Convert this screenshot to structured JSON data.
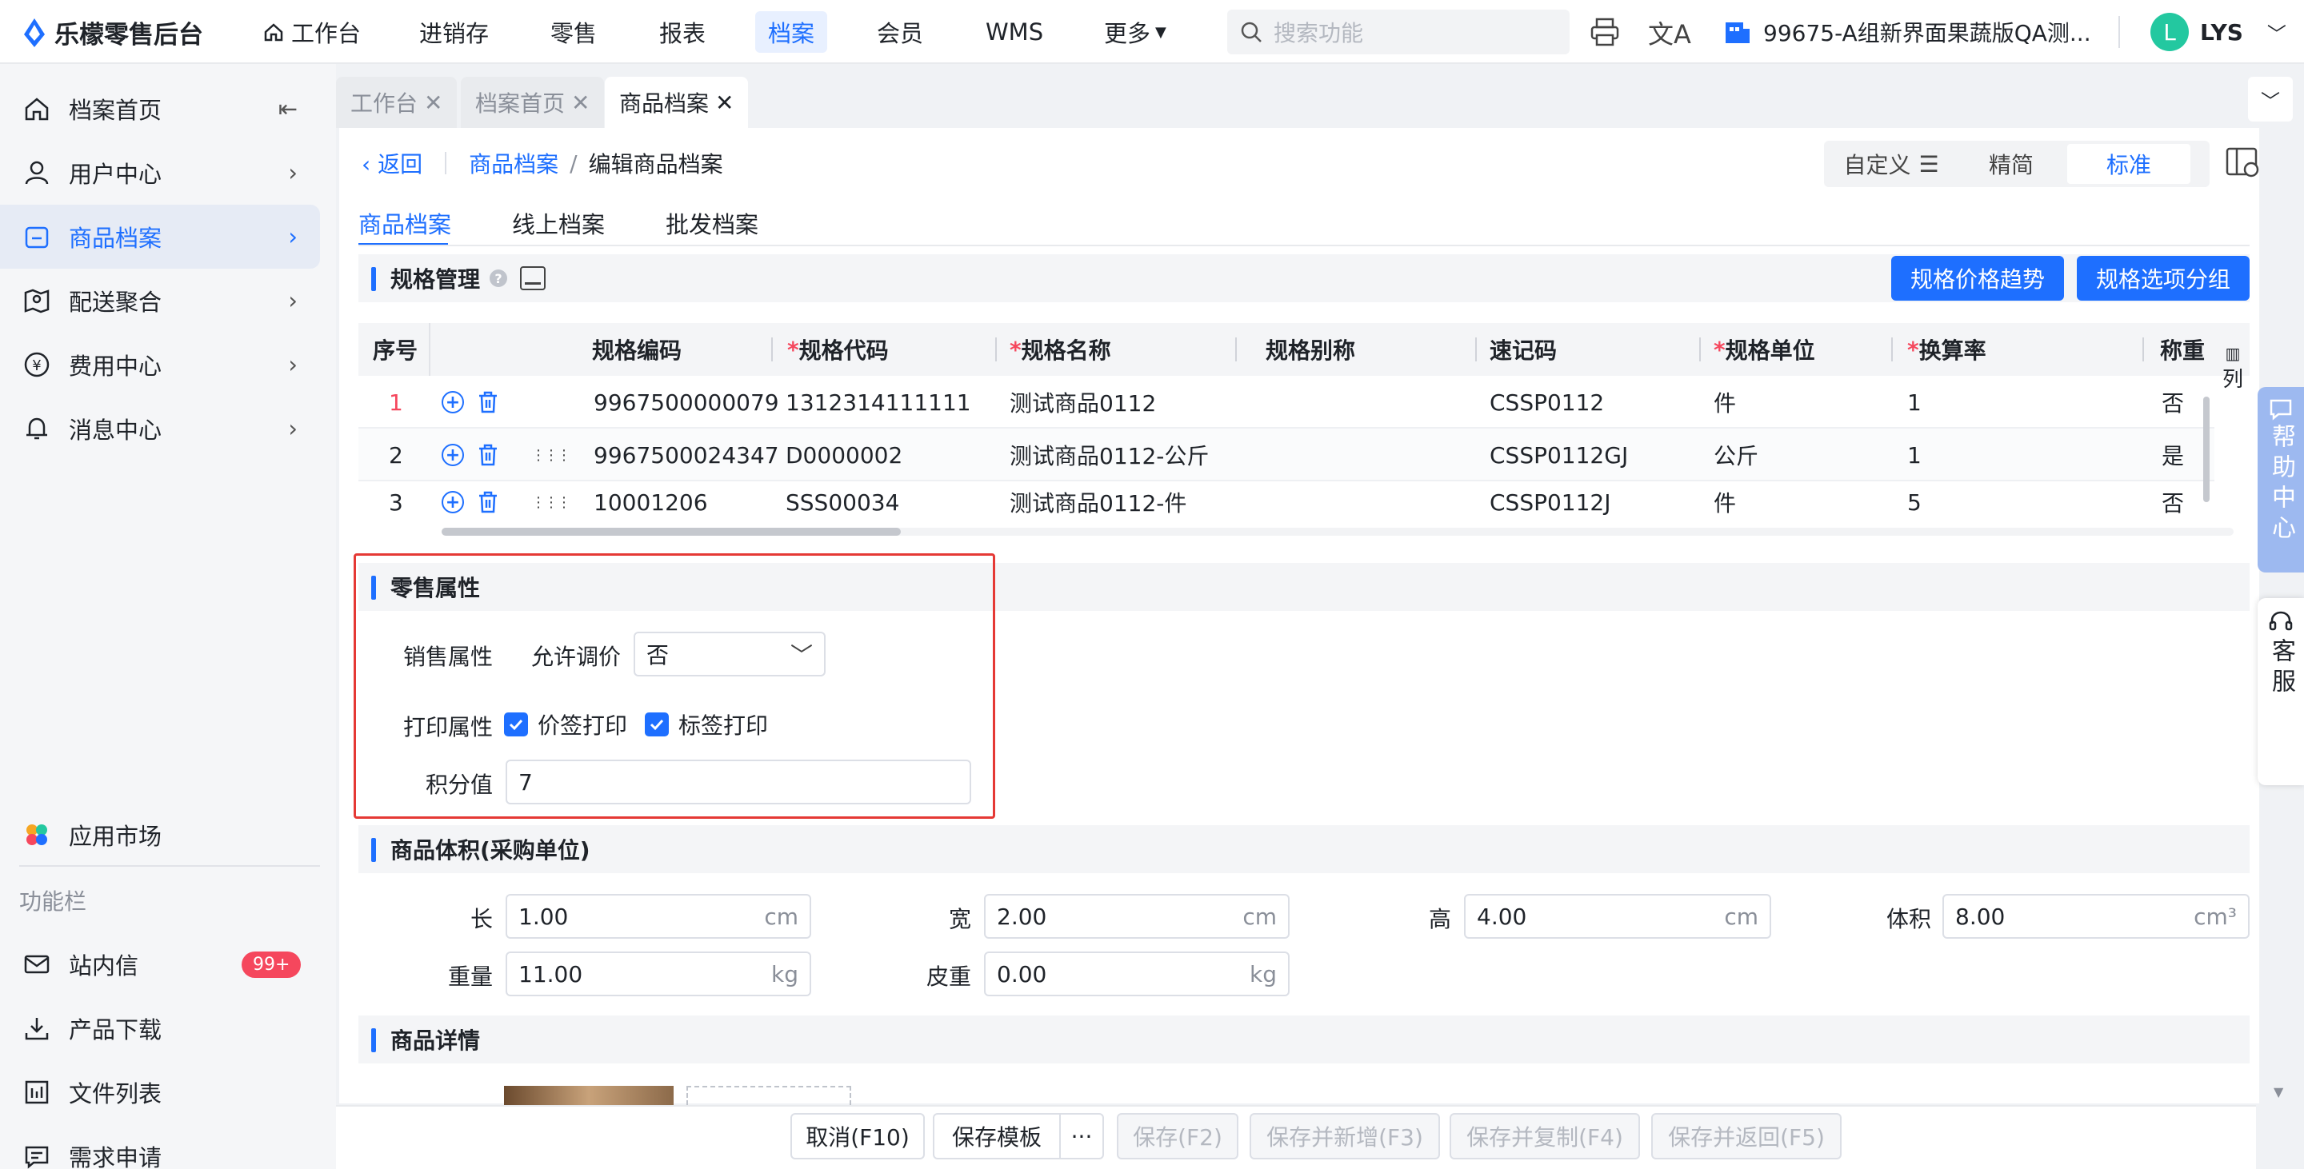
{
  "app": {
    "title": "乐檬零售后台"
  },
  "top_nav": [
    {
      "label": "工作台"
    },
    {
      "label": "进销存"
    },
    {
      "label": "零售"
    },
    {
      "label": "报表"
    },
    {
      "label": "档案"
    },
    {
      "label": "会员"
    },
    {
      "label": "WMS"
    },
    {
      "label": "更多"
    }
  ],
  "search": {
    "placeholder": "搜索功能"
  },
  "store": {
    "name": "99675-A组新界面果蔬版QA测..."
  },
  "user": {
    "avatar": "L",
    "name": "LYS"
  },
  "sidebar": {
    "items": [
      {
        "label": "档案首页"
      },
      {
        "label": "用户中心"
      },
      {
        "label": "商品档案"
      },
      {
        "label": "配送聚合"
      },
      {
        "label": "费用中心"
      },
      {
        "label": "消息中心"
      }
    ],
    "app_market": "应用市场",
    "func_title": "功能栏",
    "func_items": [
      {
        "label": "站内信",
        "badge": "99+"
      },
      {
        "label": "产品下载"
      },
      {
        "label": "文件列表"
      },
      {
        "label": "需求申请"
      }
    ]
  },
  "tabs": [
    {
      "label": "工作台"
    },
    {
      "label": "档案首页"
    },
    {
      "label": "商品档案"
    }
  ],
  "breadcrumb": {
    "back": "返回",
    "parent": "商品档案",
    "sep": "/",
    "current": "编辑商品档案"
  },
  "view_modes": {
    "custom": "自定义",
    "simple": "精简",
    "standard": "标准"
  },
  "sub_tabs": [
    {
      "label": "商品档案"
    },
    {
      "label": "线上档案"
    },
    {
      "label": "批发档案"
    }
  ],
  "spec": {
    "title": "规格管理",
    "btn_trend": "规格价格趋势",
    "btn_group": "规格选项分组",
    "columns": [
      "序号",
      "规格编码",
      "规格代码",
      "规格名称",
      "规格别称",
      "速记码",
      "规格单位",
      "换算率",
      "称重商"
    ],
    "col_setting": "列",
    "rows": [
      {
        "no": "1",
        "code": "9967500000079",
        "spec_code": "1312314111111",
        "name": "测试商品0112",
        "alias": "",
        "short": "CSSP0112",
        "unit": "件",
        "rate": "1",
        "weigh": "否"
      },
      {
        "no": "2",
        "code": "9967500024347",
        "spec_code": "D0000002",
        "name": "测试商品0112-公斤",
        "alias": "",
        "short": "CSSP0112GJ",
        "unit": "公斤",
        "rate": "1",
        "weigh": "是"
      },
      {
        "no": "3",
        "code": "10001206",
        "spec_code": "SSS00034",
        "name": "测试商品0112-件",
        "alias": "",
        "short": "CSSP0112J",
        "unit": "件",
        "rate": "5",
        "weigh": "否"
      }
    ]
  },
  "retail": {
    "title": "零售属性",
    "sale_label": "销售属性",
    "allow_label": "允许调价",
    "allow_value": "否",
    "print_label": "打印属性",
    "price_print": "价签打印",
    "label_print": "标签打印",
    "points_label": "积分值",
    "points_value": "7"
  },
  "volume": {
    "title": "商品体积(采购单位)",
    "length_label": "长",
    "length": "1.00",
    "length_unit": "cm",
    "width_label": "宽",
    "width": "2.00",
    "width_unit": "cm",
    "height_label": "高",
    "height": "4.00",
    "height_unit": "cm",
    "vol_label": "体积",
    "vol": "8.00",
    "vol_unit": "cm³",
    "weight_label": "重量",
    "weight": "11.00",
    "weight_unit": "kg",
    "tare_label": "皮重",
    "tare": "0.00",
    "tare_unit": "kg"
  },
  "detail": {
    "title": "商品详情"
  },
  "footer": {
    "cancel": "取消(F10)",
    "save_tpl": "保存模板",
    "more": "···",
    "save": "保存(F2)",
    "save_new": "保存并新增(F3)",
    "save_copy": "保存并复制(F4)",
    "save_back": "保存并返回(F5)"
  },
  "float": {
    "help": "帮助中心",
    "cs": "客服"
  },
  "colors": {
    "primary": "#1e6fff",
    "highlight_border": "#e53935",
    "badge": "#f5475d"
  }
}
